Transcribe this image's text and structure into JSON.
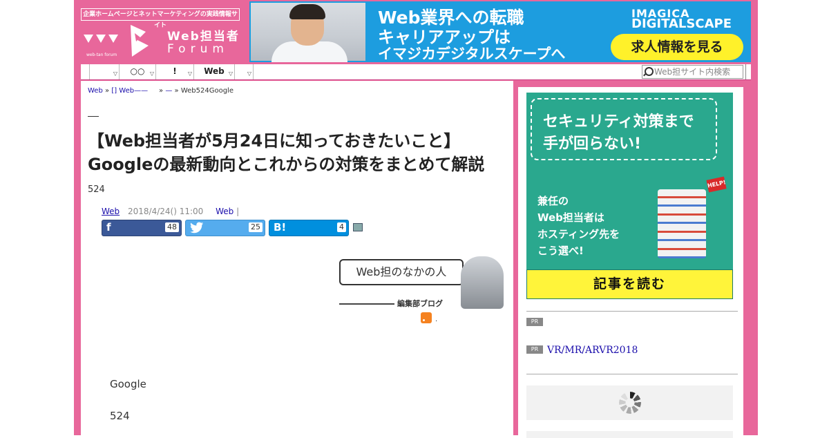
{
  "header": {
    "tagline": "企業ホームページとネットマーケティングの実践情報サイト",
    "logo_title": "Web担当者",
    "logo_forum": "Forum",
    "logo_sub": "web-tan forum"
  },
  "banner": {
    "line1": "Web業界への転職",
    "line2": "キャリアアップは",
    "line3": "イマジカデジタルスケープへ",
    "brand1": "IMAGICA",
    "brand2": "DIGITALSCAPE",
    "cta": "求人情報を見る"
  },
  "nav": {
    "items": [
      {
        "label": ""
      },
      {
        "label": "○○"
      },
      {
        "label": "!"
      },
      {
        "label": "Web"
      },
      {
        "label": ""
      }
    ],
    "search_placeholder": "Web担サイト内検索"
  },
  "breadcrumb": {
    "home": "Web",
    "sep1": "»",
    "section": "[] Web——",
    "sep2": "»",
    "sub": "—",
    "sep3": "»",
    "current": "Web524Google"
  },
  "article": {
    "title": "【Web担当者が5月24日に知っておきたいこと】Googleの最新動向とこれからの対策をまとめて解説",
    "lead": "524",
    "author": "Web",
    "date": "2018/4/24() 11:00",
    "category": "Web",
    "category_sep": "|",
    "share": {
      "facebook_count": "48",
      "twitter_count": "25",
      "hatena_count": "4"
    },
    "blog": {
      "bubble": "Web担のなかの人",
      "label": "編集部ブログ"
    },
    "rss_dot": ".",
    "body": [
      "Google",
      "524"
    ]
  },
  "sidebar": {
    "ad": {
      "headline1": "セキュリティ対策まで",
      "headline2": "手が回らない!",
      "text1": "兼任の",
      "text2": "Web担当者は",
      "text3": "ホスティング先を",
      "text4": "こう選べ!",
      "help": "HELP!",
      "button": "記事を読む"
    },
    "pr_label": "PR",
    "pr_link": "VR/MR/ARVR2018"
  },
  "colors": {
    "brand_pink": "#e8679b",
    "banner_blue": "#1d9ddf",
    "ad_green": "#2aa88e",
    "cta_yellow": "#fff12a",
    "facebook": "#3b5998",
    "twitter": "#55acee",
    "hatena": "#008fde"
  }
}
